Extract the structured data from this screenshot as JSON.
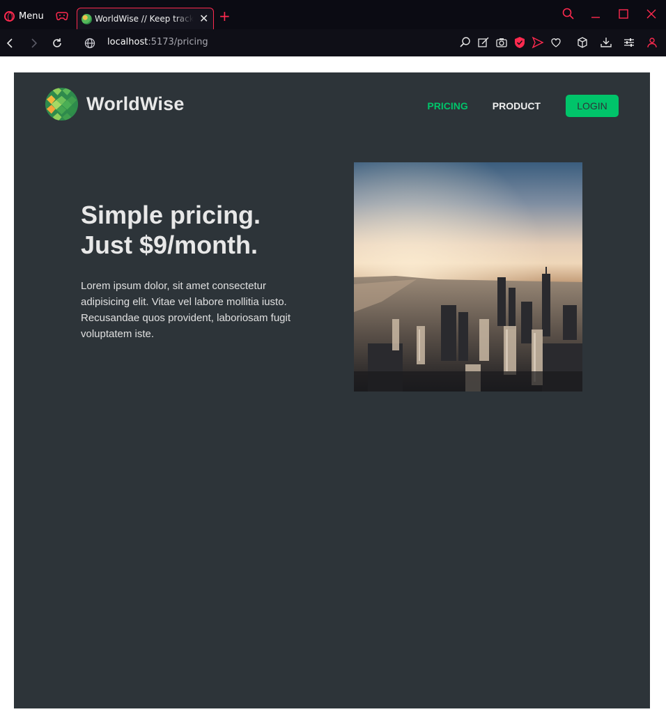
{
  "browser": {
    "menu_label": "Menu",
    "tab_title": "WorldWise // Keep track of",
    "url_host": "localhost",
    "url_path": ":5173/pricing"
  },
  "app": {
    "logo_text": "WorldWise",
    "nav": [
      {
        "label": "Pricing",
        "active": true
      },
      {
        "label": "Product",
        "active": false
      }
    ],
    "login_label": "Login",
    "accent_color": "#00c46a",
    "background_color": "#2d3439"
  },
  "hero": {
    "headline_line1": "Simple pricing.",
    "headline_line2": "Just $9/month.",
    "body": "Lorem ipsum dolor, sit amet consectetur adipisicing elit. Vitae vel labore mollitia iusto. Recusandae quos provident, laboriosam fugit voluptatem iste."
  }
}
